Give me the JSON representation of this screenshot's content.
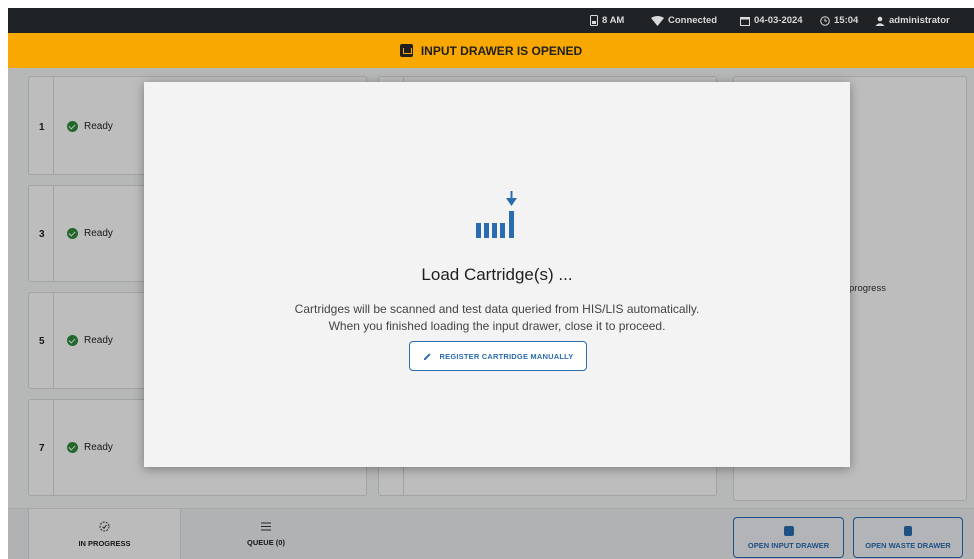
{
  "statusbar": {
    "battery": "8 AM",
    "network": "Connected",
    "date": "04-03-2024",
    "time": "15:04",
    "user": "administrator"
  },
  "banner": {
    "text": "INPUT DRAWER IS OPENED"
  },
  "slots": [
    {
      "number": "1",
      "status": "Ready"
    },
    {
      "number": "3",
      "status": "Ready"
    },
    {
      "number": "5",
      "status": "Ready"
    },
    {
      "number": "7",
      "status": "Ready"
    }
  ],
  "right_panel": {
    "text": "progress"
  },
  "modal": {
    "title": "Load Cartridge(s) ...",
    "line1": "Cartridges will be scanned and test data queried from HIS/LIS automatically.",
    "line2": "When you finished loading the input drawer, close it to proceed.",
    "register_button": "REGISTER CARTRIDGE MANUALLY"
  },
  "bottombar": {
    "tab_in_progress": "IN PROGRESS",
    "tab_queue": "QUEUE (0)",
    "open_input_drawer": "OPEN INPUT DRAWER",
    "open_waste_drawer": "OPEN WASTE DRAWER"
  },
  "colors": {
    "banner": "#f8a800",
    "accent_blue": "#2b6cb0",
    "status_ok": "#2e8b3a",
    "statusbar_bg": "#202326"
  }
}
